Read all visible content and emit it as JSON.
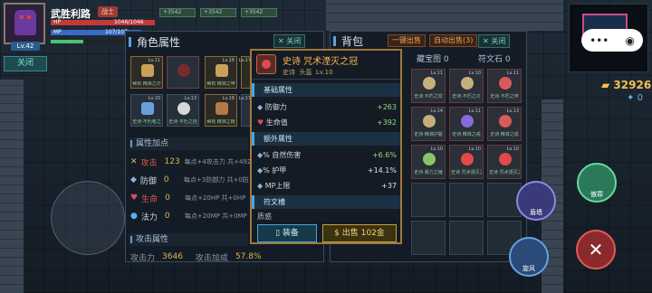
{
  "player": {
    "name": "武胜利路",
    "rank": "战士",
    "level": "Lv.42",
    "hp_text": "HP",
    "mp_text": "MP",
    "hp_value": "1046/1046",
    "mp_value": "107/107"
  },
  "buffs": [
    "+3542",
    "+3542",
    "+3542"
  ],
  "side_close": "关闭",
  "char_panel": {
    "title": "角色属性",
    "close": "关闭",
    "equipment": [
      {
        "lv": "Lv.11",
        "label": "稀有 精准之刃",
        "color": "#c9a15a"
      },
      {
        "lv": "",
        "label": "",
        "color": "#7a2a2a"
      },
      {
        "lv": "Lv.16",
        "label": "稀有 精准之甲",
        "color": "#c9a15a"
      },
      {
        "lv": "Lv.17",
        "label": "稀有 精准之甲",
        "color": "#c9a15a"
      },
      {
        "lv": "Lv.10",
        "label": "史诗 不朽者之",
        "color": "#6aa0d8"
      },
      {
        "lv": "Lv.13",
        "label": "史诗 不朽之挂",
        "color": "#d8d8d8"
      },
      {
        "lv": "Lv.16",
        "label": "稀有 精准之靴",
        "color": "#b07a4a"
      },
      {
        "lv": "Lv.17",
        "label": "史诗 不朽之戒",
        "color": "#d8d8d8"
      }
    ],
    "attr_points_title": "属性加点",
    "attrs": [
      {
        "name": "攻击",
        "value": "123",
        "desc": "每点+4攻击力 共+492"
      },
      {
        "name": "防御",
        "value": "0",
        "desc": "每点+3防御力 共+0防"
      },
      {
        "name": "生命",
        "value": "0",
        "desc": "每点+20HP 共+0HP"
      },
      {
        "name": "法力",
        "value": "0",
        "desc": "每点+20MP 共+0MP"
      }
    ],
    "attack_title": "攻击属性",
    "footer": [
      {
        "name": "攻击力",
        "value": "3646"
      },
      {
        "name": "攻击加成",
        "value": "57.8%"
      }
    ]
  },
  "bag": {
    "title": "背包",
    "btn_sell": "一键出售",
    "btn_auto": "自动出售(3)",
    "close": "关闭",
    "tabs": [
      "藏宝图 0",
      "符文石 0"
    ],
    "items": [
      {
        "lv": "Lv.11",
        "label": "史诗 不朽之杖",
        "color": "#c4b07a"
      },
      {
        "lv": "Lv.10",
        "label": "史诗 不朽之刃",
        "color": "#c4b07a"
      },
      {
        "lv": "Lv.11",
        "label": "史诗 不朽之甲",
        "color": "#d85a5a"
      },
      {
        "lv": "Lv.14",
        "label": "史诗 精准护腿",
        "color": "#c4b07a"
      },
      {
        "lv": "Lv.11",
        "label": "史诗 精准之戒",
        "color": "#8a6ad8"
      },
      {
        "lv": "Lv.13",
        "label": "史诗 精准之戒",
        "color": "#d85a5a"
      },
      {
        "lv": "Lv.10",
        "label": "史诗 暴力之锤",
        "color": "#8ac46a"
      },
      {
        "lv": "Lv.10",
        "label": "史诗 咒术漫灭之冠",
        "color": "#e04a4a"
      },
      {
        "lv": "Lv.10",
        "label": "史诗 咒术漫灭之冠",
        "color": "#e04a4a"
      }
    ]
  },
  "tooltip": {
    "name": "史诗 咒术湮灭之冠",
    "quality": "史诗",
    "slot": "头盔",
    "level": "Lv.10",
    "base_title": "基础属性",
    "base": [
      {
        "name": "防御力",
        "value": "+263"
      },
      {
        "name": "生命值",
        "value": "+392"
      }
    ],
    "extra_title": "额外属性",
    "extra": [
      {
        "name": "% 自然伤害",
        "value": "+6.6%"
      },
      {
        "name": "% 护甲",
        "value": "+14.1%"
      },
      {
        "name": "MP上限",
        "value": "+37"
      }
    ],
    "rune_title": "符文槽",
    "rune_item": "质惑",
    "equip_btn": "装备",
    "sell_btn": "$ 出售 102金"
  },
  "hud": {
    "gold": "32926",
    "gems": "0",
    "skill_labels": [
      "傲罪",
      "旋风",
      "盾墙"
    ]
  }
}
